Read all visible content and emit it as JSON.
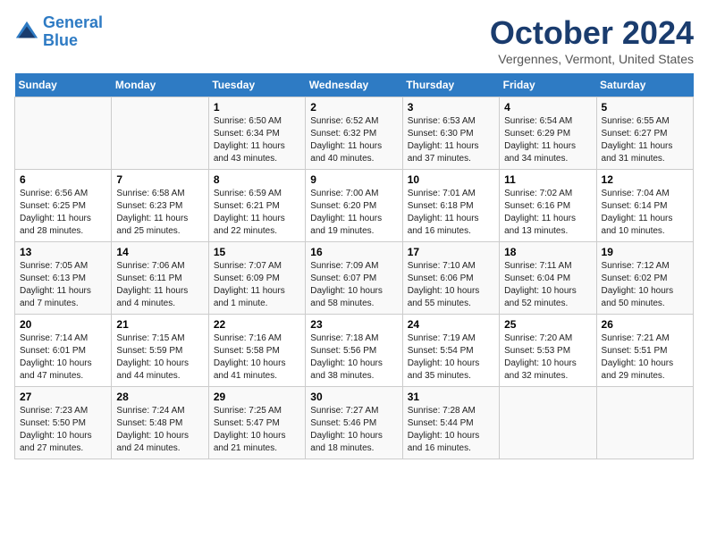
{
  "header": {
    "logo_line1": "General",
    "logo_line2": "Blue",
    "title": "October 2024",
    "location": "Vergennes, Vermont, United States"
  },
  "days_of_week": [
    "Sunday",
    "Monday",
    "Tuesday",
    "Wednesday",
    "Thursday",
    "Friday",
    "Saturday"
  ],
  "weeks": [
    [
      {
        "day": "",
        "info": ""
      },
      {
        "day": "",
        "info": ""
      },
      {
        "day": "1",
        "info": "Sunrise: 6:50 AM\nSunset: 6:34 PM\nDaylight: 11 hours and 43 minutes."
      },
      {
        "day": "2",
        "info": "Sunrise: 6:52 AM\nSunset: 6:32 PM\nDaylight: 11 hours and 40 minutes."
      },
      {
        "day": "3",
        "info": "Sunrise: 6:53 AM\nSunset: 6:30 PM\nDaylight: 11 hours and 37 minutes."
      },
      {
        "day": "4",
        "info": "Sunrise: 6:54 AM\nSunset: 6:29 PM\nDaylight: 11 hours and 34 minutes."
      },
      {
        "day": "5",
        "info": "Sunrise: 6:55 AM\nSunset: 6:27 PM\nDaylight: 11 hours and 31 minutes."
      }
    ],
    [
      {
        "day": "6",
        "info": "Sunrise: 6:56 AM\nSunset: 6:25 PM\nDaylight: 11 hours and 28 minutes."
      },
      {
        "day": "7",
        "info": "Sunrise: 6:58 AM\nSunset: 6:23 PM\nDaylight: 11 hours and 25 minutes."
      },
      {
        "day": "8",
        "info": "Sunrise: 6:59 AM\nSunset: 6:21 PM\nDaylight: 11 hours and 22 minutes."
      },
      {
        "day": "9",
        "info": "Sunrise: 7:00 AM\nSunset: 6:20 PM\nDaylight: 11 hours and 19 minutes."
      },
      {
        "day": "10",
        "info": "Sunrise: 7:01 AM\nSunset: 6:18 PM\nDaylight: 11 hours and 16 minutes."
      },
      {
        "day": "11",
        "info": "Sunrise: 7:02 AM\nSunset: 6:16 PM\nDaylight: 11 hours and 13 minutes."
      },
      {
        "day": "12",
        "info": "Sunrise: 7:04 AM\nSunset: 6:14 PM\nDaylight: 11 hours and 10 minutes."
      }
    ],
    [
      {
        "day": "13",
        "info": "Sunrise: 7:05 AM\nSunset: 6:13 PM\nDaylight: 11 hours and 7 minutes."
      },
      {
        "day": "14",
        "info": "Sunrise: 7:06 AM\nSunset: 6:11 PM\nDaylight: 11 hours and 4 minutes."
      },
      {
        "day": "15",
        "info": "Sunrise: 7:07 AM\nSunset: 6:09 PM\nDaylight: 11 hours and 1 minute."
      },
      {
        "day": "16",
        "info": "Sunrise: 7:09 AM\nSunset: 6:07 PM\nDaylight: 10 hours and 58 minutes."
      },
      {
        "day": "17",
        "info": "Sunrise: 7:10 AM\nSunset: 6:06 PM\nDaylight: 10 hours and 55 minutes."
      },
      {
        "day": "18",
        "info": "Sunrise: 7:11 AM\nSunset: 6:04 PM\nDaylight: 10 hours and 52 minutes."
      },
      {
        "day": "19",
        "info": "Sunrise: 7:12 AM\nSunset: 6:02 PM\nDaylight: 10 hours and 50 minutes."
      }
    ],
    [
      {
        "day": "20",
        "info": "Sunrise: 7:14 AM\nSunset: 6:01 PM\nDaylight: 10 hours and 47 minutes."
      },
      {
        "day": "21",
        "info": "Sunrise: 7:15 AM\nSunset: 5:59 PM\nDaylight: 10 hours and 44 minutes."
      },
      {
        "day": "22",
        "info": "Sunrise: 7:16 AM\nSunset: 5:58 PM\nDaylight: 10 hours and 41 minutes."
      },
      {
        "day": "23",
        "info": "Sunrise: 7:18 AM\nSunset: 5:56 PM\nDaylight: 10 hours and 38 minutes."
      },
      {
        "day": "24",
        "info": "Sunrise: 7:19 AM\nSunset: 5:54 PM\nDaylight: 10 hours and 35 minutes."
      },
      {
        "day": "25",
        "info": "Sunrise: 7:20 AM\nSunset: 5:53 PM\nDaylight: 10 hours and 32 minutes."
      },
      {
        "day": "26",
        "info": "Sunrise: 7:21 AM\nSunset: 5:51 PM\nDaylight: 10 hours and 29 minutes."
      }
    ],
    [
      {
        "day": "27",
        "info": "Sunrise: 7:23 AM\nSunset: 5:50 PM\nDaylight: 10 hours and 27 minutes."
      },
      {
        "day": "28",
        "info": "Sunrise: 7:24 AM\nSunset: 5:48 PM\nDaylight: 10 hours and 24 minutes."
      },
      {
        "day": "29",
        "info": "Sunrise: 7:25 AM\nSunset: 5:47 PM\nDaylight: 10 hours and 21 minutes."
      },
      {
        "day": "30",
        "info": "Sunrise: 7:27 AM\nSunset: 5:46 PM\nDaylight: 10 hours and 18 minutes."
      },
      {
        "day": "31",
        "info": "Sunrise: 7:28 AM\nSunset: 5:44 PM\nDaylight: 10 hours and 16 minutes."
      },
      {
        "day": "",
        "info": ""
      },
      {
        "day": "",
        "info": ""
      }
    ]
  ]
}
